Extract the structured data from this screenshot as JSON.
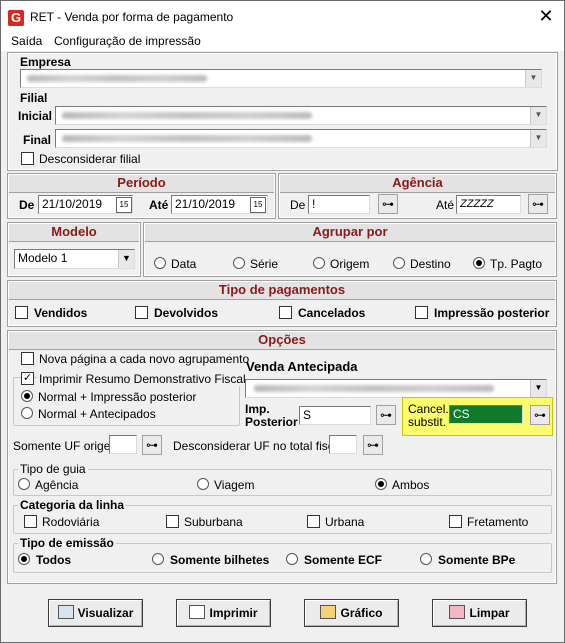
{
  "window": {
    "title": "RET - Venda por forma de pagamento",
    "app_icon": "G",
    "close_glyph": "✕"
  },
  "menu": {
    "items": [
      "Saída",
      "Configuração de impressão"
    ]
  },
  "empresa": {
    "label": "Empresa",
    "value": ""
  },
  "filial": {
    "label": "Filial",
    "inicial_label": "Inicial",
    "final_label": "Final",
    "desconsiderar": "Desconsiderar filial",
    "desconsiderar_checked": false
  },
  "periodo": {
    "title": "Período",
    "de_label": "De",
    "de_value": "21/10/2019",
    "ate_label": "Até",
    "ate_value": "21/10/2019",
    "cal_glyph": "15"
  },
  "agencia": {
    "title": "Agência",
    "de_label": "De",
    "de_value": "!",
    "ate_label": "Até",
    "ate_value": "ZZZZZ"
  },
  "modelo": {
    "title": "Modelo",
    "value": "Modelo 1"
  },
  "agrupar": {
    "title": "Agrupar por",
    "options": [
      "Data",
      "Série",
      "Origem",
      "Destino",
      "Tp. Pagto"
    ],
    "selected": "Tp. Pagto"
  },
  "tipo_pagamentos": {
    "title": "Tipo de pagamentos",
    "options": [
      "Vendidos",
      "Devolvidos",
      "Cancelados",
      "Impressão posterior"
    ]
  },
  "opcoes": {
    "title": "Opções",
    "nova_pagina": "Nova página a cada novo agrupamento",
    "imprimir_resumo": "Imprimir Resumo Demonstrativo Fiscal",
    "resumo_options": [
      "Normal + Impressão posterior",
      "Normal + Antecipados"
    ],
    "resumo_selected": "Normal + Impressão posterior",
    "venda_antecipada": "Venda Antecipada",
    "imp_posterior_label_1": "Imp.",
    "imp_posterior_label_2": "Posterior",
    "imp_posterior_value": "S",
    "cancel_label_1": "Cancel.",
    "cancel_label_2": "substit.",
    "cancel_value": "CS",
    "somente_uf": "Somente UF origem",
    "desconsiderar_uf": "Desconsiderar UF no total fiscal",
    "highlight_color": "#fbfb6e"
  },
  "tipo_guia": {
    "title": "Tipo de guia",
    "options": [
      "Agência",
      "Viagem",
      "Ambos"
    ],
    "selected": "Ambos"
  },
  "categoria": {
    "title": "Categoria da linha",
    "options": [
      "Rodoviária",
      "Suburbana",
      "Urbana",
      "Fretamento"
    ]
  },
  "tipo_emissao": {
    "title": "Tipo de emissão",
    "options": [
      "Todos",
      "Somente bilhetes",
      "Somente ECF",
      "Somente BPe"
    ],
    "selected": "Todos"
  },
  "buttons": {
    "visualizar": "Visualizar",
    "imprimir": "Imprimir",
    "grafico": "Gráfico",
    "limpar": "Limpar"
  },
  "colors": {
    "section_title": "#8b1a1a"
  }
}
